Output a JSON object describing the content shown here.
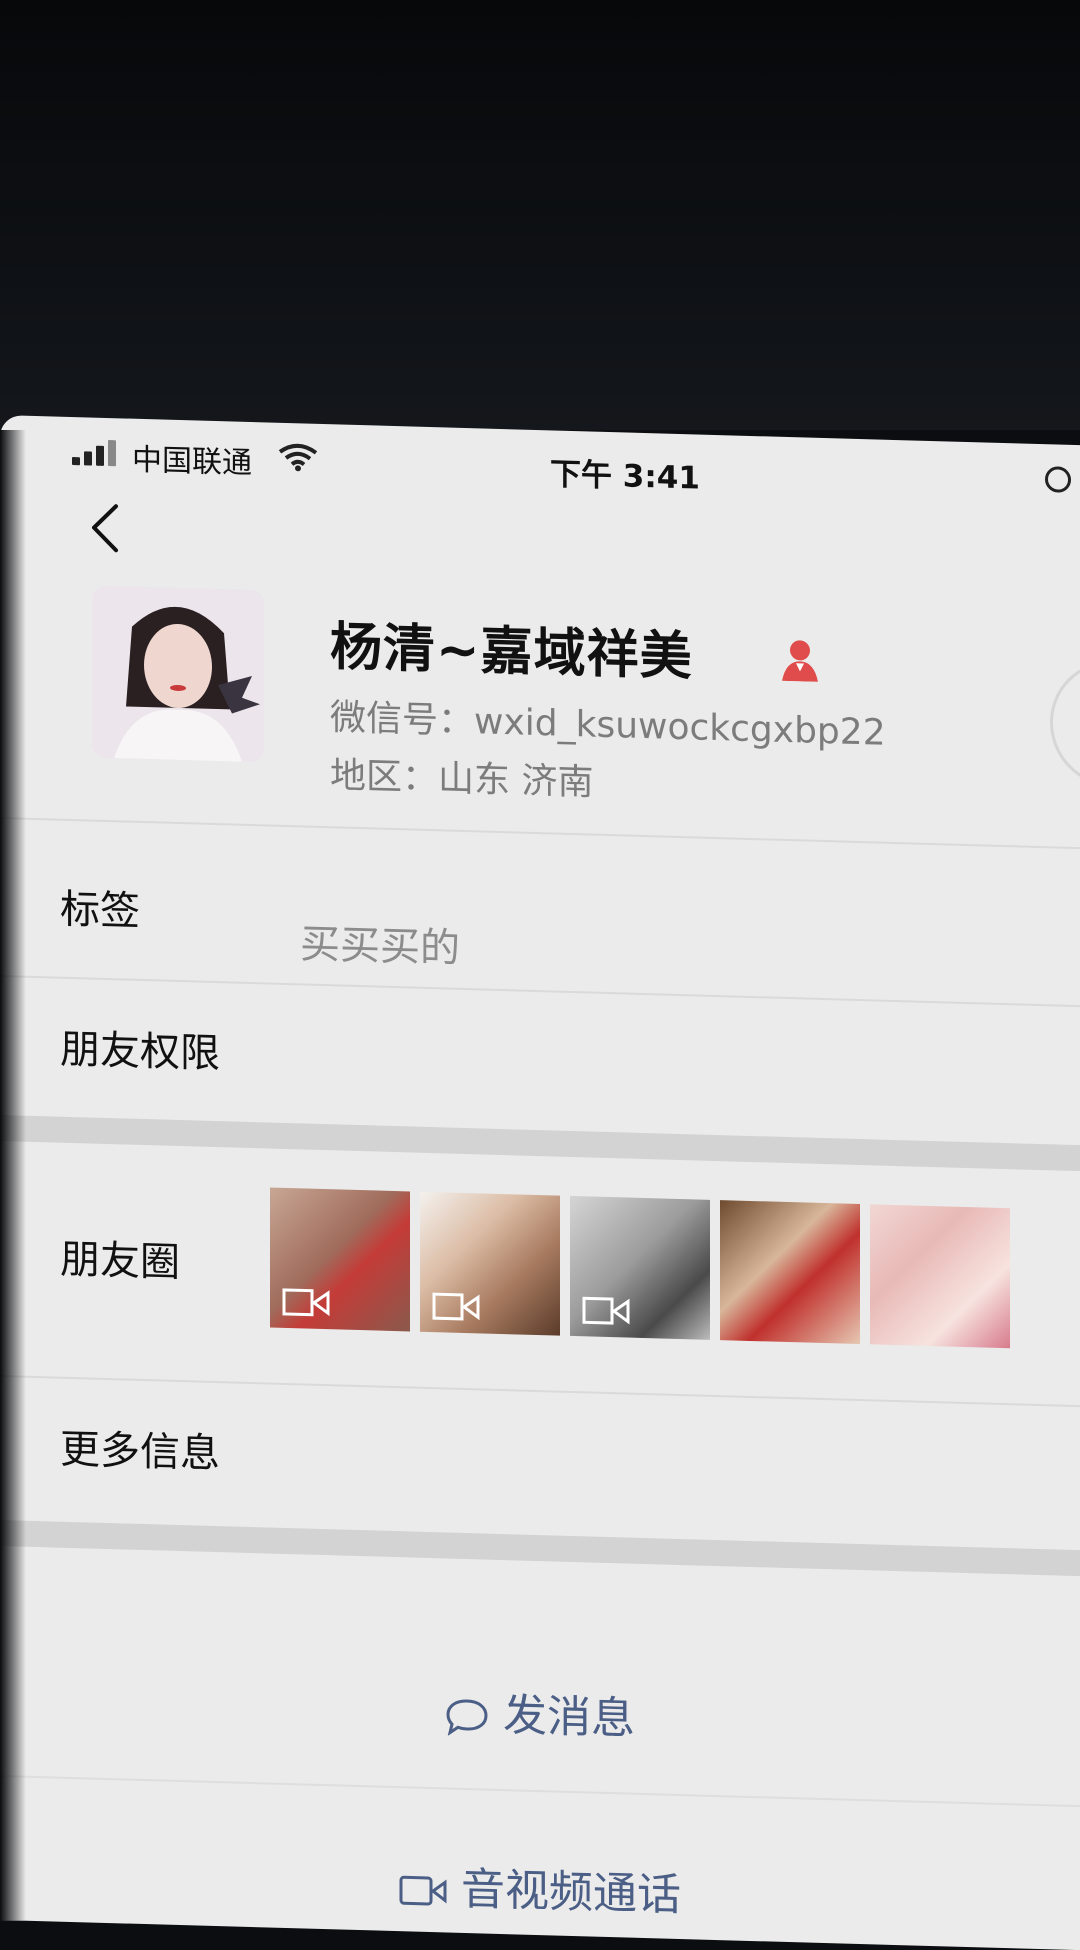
{
  "status_bar": {
    "carrier": "中国联通",
    "time": "下午 3:41"
  },
  "profile": {
    "name": "杨清~嘉域祥美",
    "wechat_id": "微信号：wxid_ksuwockcgxbp22",
    "region": "地区：山东 济南",
    "gender_icon": "female-user-icon"
  },
  "rows": {
    "tags_label": "标签",
    "tags_value": "买买买的",
    "friend_permissions_label": "朋友权限",
    "moments_label": "朋友圈",
    "more_info_label": "更多信息"
  },
  "moments": {
    "thumbnails": [
      {
        "has_video": true
      },
      {
        "has_video": true
      },
      {
        "has_video": true
      },
      {
        "has_video": false
      },
      {
        "has_video": false
      }
    ]
  },
  "actions": {
    "send_message": "发消息",
    "video_call": "音视频通话"
  },
  "colors": {
    "background": "#ebebeb",
    "accent_text": "#4b5e86",
    "female_icon": "#e04b4b"
  }
}
